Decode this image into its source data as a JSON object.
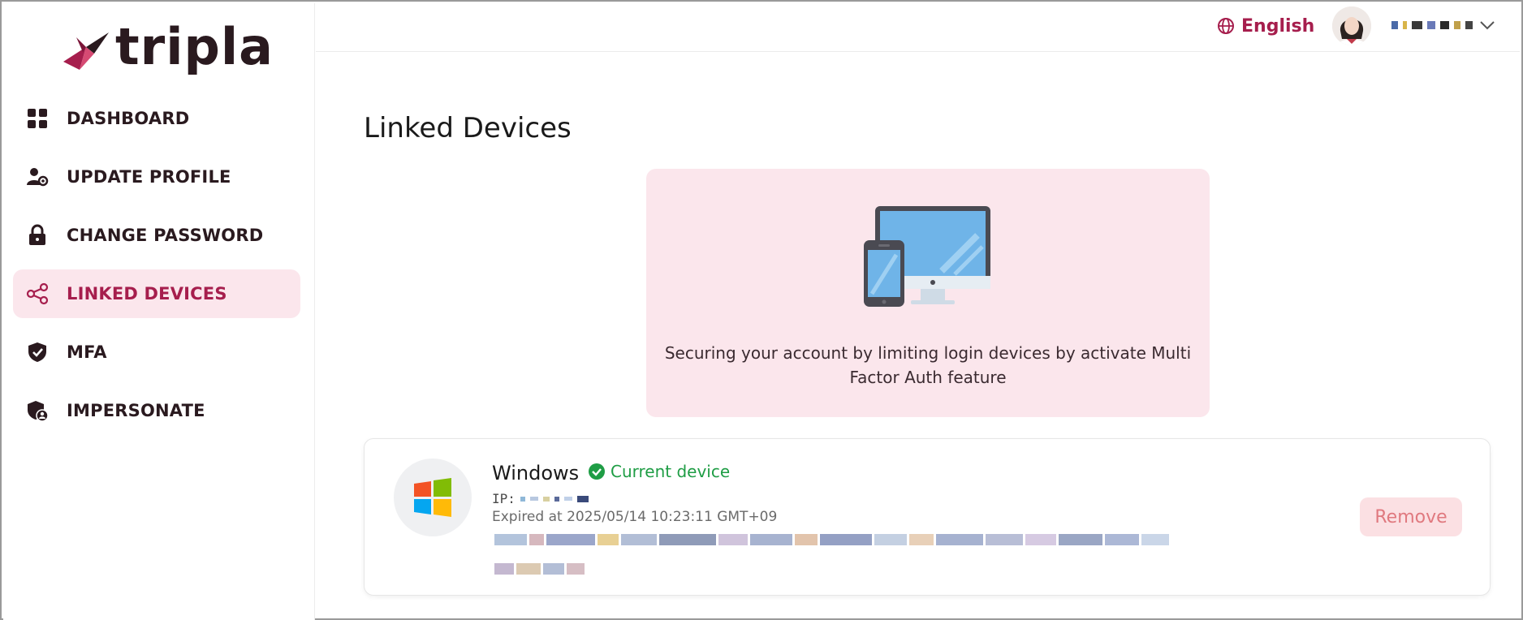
{
  "app": {
    "brand": "tripla",
    "brand_color": "#a61e4d"
  },
  "sidebar": {
    "items": [
      {
        "label": "DASHBOARD",
        "icon": "dashboard-grid-icon",
        "active": false
      },
      {
        "label": "UPDATE PROFILE",
        "icon": "user-gear-icon",
        "active": false
      },
      {
        "label": "CHANGE PASSWORD",
        "icon": "lock-icon",
        "active": false
      },
      {
        "label": "LINKED DEVICES",
        "icon": "share-nodes-icon",
        "active": true
      },
      {
        "label": "MFA",
        "icon": "shield-check-icon",
        "active": false
      },
      {
        "label": "IMPERSONATE",
        "icon": "shield-user-icon",
        "active": false
      }
    ]
  },
  "header": {
    "language": "English",
    "language_icon": "globe-icon",
    "avatar_icon": "user-avatar",
    "menu_icon": "chevron-down-icon"
  },
  "main": {
    "title": "Linked Devices",
    "banner": {
      "illustration": "devices-illustration",
      "text": "Securing your account by limiting login devices by activate Multi Factor Auth feature"
    },
    "devices": [
      {
        "os": "Windows",
        "os_icon": "windows-logo-icon",
        "current_label": "Current device",
        "ip_label": "IP:",
        "expired": "Expired at 2025/05/14 10:23:11 GMT+09",
        "remove_label": "Remove"
      }
    ]
  }
}
